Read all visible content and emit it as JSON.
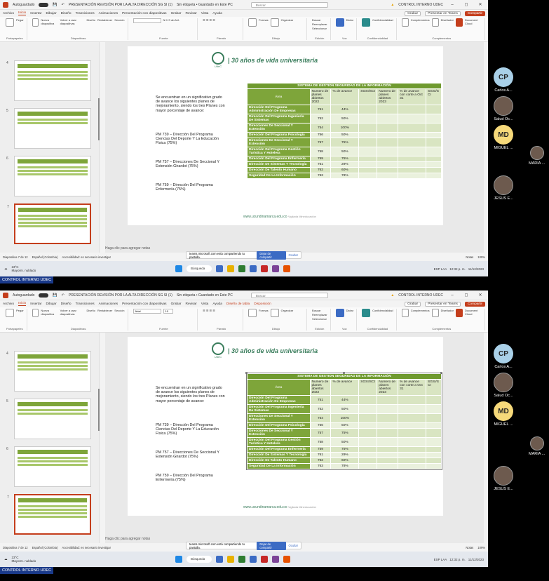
{
  "window": {
    "autosave": "Autoguardado",
    "doc_title": "PRESENTACIÓN REVISIÓN POR LA ALTA DIRECCIÓN SG SI (1)",
    "label_status": "Sin etiqueta • Guardado en Este PC",
    "search_placeholder": "Buscar",
    "user": "CONTROL INTERNO UDEC"
  },
  "menu": {
    "items_1": [
      "Archivo",
      "Inicio",
      "Insertar",
      "Dibujar",
      "Diseño",
      "Transiciones",
      "Animaciones",
      "Presentación con diapositivas",
      "Grabar",
      "Revisar",
      "Vista",
      "Ayuda"
    ],
    "items_2": [
      "Archivo",
      "Inicio",
      "Insertar",
      "Dibujar",
      "Diseño",
      "Transiciones",
      "Animaciones",
      "Presentación con diapositivas",
      "Grabar",
      "Revisar",
      "Vista",
      "Ayuda",
      "Diseño de tabla",
      "Disposición"
    ],
    "record": "Grabar",
    "present_teams": "Presentar en Teams",
    "share": "Compartir"
  },
  "ribbon": {
    "groups": [
      "Portapapeles",
      "Diapositivas",
      "Fuente",
      "Párrafo",
      "Dibujo",
      "Edición",
      "Voz",
      "Confidencialidad",
      "Complementos"
    ],
    "paste": "Pegar",
    "new_slide": "Nueva diapositiva",
    "reuse": "Volver a usar diapositivas",
    "layout": "Diseño",
    "reset": "Restablecer",
    "section": "Sección",
    "font_name_2": "Arial",
    "font_size_2": "10",
    "shapes": "Formas",
    "arrange": "Organizar",
    "find": "Buscar",
    "replace": "Reemplazar",
    "select": "Seleccionar",
    "dictate": "Dictar",
    "sensitivity": "Confidencialidad",
    "addins": "Complementos",
    "designer": "Diseñador",
    "cloud": "Document Cloud"
  },
  "slide": {
    "logo_label": "UdeC",
    "title": "| 30 años de vida universitaria",
    "paragraphs": [
      "Se encuentran en un significativo grado de avance los siguientes planes de mejoramiento, siendo los tres Planes con mayor porcentaje de avance:",
      "PM 739 – Dirección Del Programa Ciencias Del Deporte Y La Educación Física (75%)",
      "PM 757 – Direcciones De Seccional Y Extensión Girardot (75%)",
      "PM 759 – Dirección Del Programa Enfermería (75%)"
    ],
    "table": {
      "caption": "SISTEMA DE GESTION SEGURIDAD DE LA INFORMACIÓN",
      "headers": [
        "Área",
        "Numero de planes abiertos 2022",
        "% de avance",
        "SGSI/SCI",
        "Numero de planes abiertos 2023",
        "% de avance con corte a Oct 31",
        "SGSI/S CI"
      ],
      "rows": [
        {
          "area": "Dirección Del Programa Administración De Empresas",
          "num": "751",
          "pct": "44%"
        },
        {
          "area": "Dirección Del Programa Ingeniería De Sistemas",
          "num": "752",
          "pct": "50%"
        },
        {
          "area": "Direcciones De Seccional Y Extensión",
          "num": "754",
          "pct": "100%"
        },
        {
          "area": "Dirección Del Programa Psicología",
          "num": "756",
          "pct": "50%"
        },
        {
          "area": "Direcciones De Seccional Y Extensión",
          "num": "757",
          "pct": "75%"
        },
        {
          "area": "Dirección Del Programa Gestión Turística Y Hotelera",
          "num": "758",
          "pct": "50%"
        },
        {
          "area": "Dirección Del Programa Enfermería",
          "num": "759",
          "pct": "75%"
        },
        {
          "area": "Dirección De Sistemas Y Tecnología",
          "num": "761",
          "pct": "29%"
        },
        {
          "area": "Dirección De Talento Humano",
          "num": "762",
          "pct": "60%"
        },
        {
          "area": "Seguridad De La Información",
          "num": "763",
          "pct": "78%"
        }
      ]
    },
    "footer_url": "www.ucundinamarca.edu.co",
    "footer_sub": "Vigilada Mineducación"
  },
  "notes": "Haga clic para agregar notas",
  "share_banner": {
    "text": "teams.microsoft.com está compartiendo tu pantalla.",
    "stop": "Dejar de compartir",
    "hide": "Ocultar"
  },
  "status": {
    "slide_1": "Diapositiva 7 de 12",
    "slide_2": "Diapositiva 7 de 12",
    "lang": "Español (Colombia)",
    "access": "Accesibilidad: es necesario investigar",
    "notes_btn": "Notas",
    "zoom": "109%"
  },
  "taskbar": {
    "temp": "23°C",
    "weather": "Mayorm. nublado",
    "search": "Búsqueda",
    "lang": "ESP LAA",
    "time": "12:32 p. m.",
    "date": "11/12/2023"
  },
  "participants": [
    {
      "initials": "CP",
      "name": "Carlos A..."
    },
    {
      "initials": "",
      "name": "Salud Oc..."
    },
    {
      "initials": "MD",
      "name": "MIGUEL ..."
    },
    {
      "initials": "",
      "name": "MARIA ..."
    },
    {
      "initials": "",
      "name": "JESUS E..."
    }
  ],
  "caption": "CONTROL INTERNO UDEC"
}
